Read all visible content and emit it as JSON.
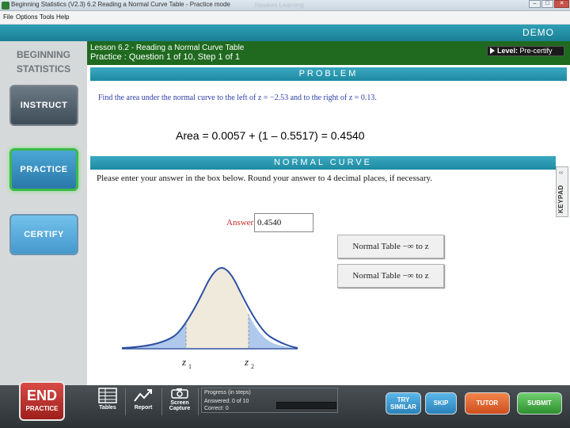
{
  "window": {
    "title": "Beginning Statistics (V2.3)   6.2 Reading a Normal Curve Table - Practice mode",
    "watermark": "Hawkes Learning",
    "minimize": "–",
    "maximize": "□",
    "close": "✕"
  },
  "menu": {
    "file": "File",
    "options": "Options",
    "tools": "Tools",
    "help": "Help"
  },
  "banner": {
    "demo": "DEMO"
  },
  "sidebar": {
    "brand_line1": "BEGINNING",
    "brand_line2": "STATISTICS",
    "instruct": "INSTRUCT",
    "practice": "PRACTICE",
    "certify": "CERTIFY"
  },
  "lesson": {
    "title": "Lesson 6.2 - Reading a Normal Curve Table",
    "step": "Practice : Question 1 of 10, Step 1 of 1",
    "level_key": "Level:",
    "level_value": "Pre-certify"
  },
  "problem": {
    "header": "PROBLEM",
    "text": "Find the area under the normal curve to the left of z = −2.53 and to the right of z = 0.13.",
    "result": "Area = 0.0057 + (1 – 0.5517) = 0.4540"
  },
  "curve_panel": {
    "header": "NORMAL CURVE",
    "instructions": "Please enter your answer in the box below.  Round your answer to 4 decimal places, if necessary.",
    "answer_label": "Answer:",
    "answer_value": "0.4540",
    "table_btn_1": "Normal Table  −∞  to  z",
    "table_btn_2": "Normal Table −∞ to z",
    "z1_label": "z",
    "z1_sub": "1",
    "z2_label": "z",
    "z2_sub": "2",
    "shading": {
      "left_tail": true,
      "right_tail": true,
      "middle_unshaded_tint": true
    }
  },
  "keypad": {
    "label": "KEYPAD",
    "chevron": "‹‹"
  },
  "toolbar": {
    "end": "END",
    "end_sub": "PRACTICE",
    "tables": "Tables",
    "report": "Report",
    "screen": "Screen",
    "capture": "Capture",
    "progress_title": "Progress (in steps)",
    "answered": "Answered:  0  of 10",
    "correct": "Correct:    0",
    "progress_fraction": 0.0,
    "try": "TRY",
    "similar": "SIMILAR",
    "skip": "SKIP",
    "tutor": "TUTOR",
    "submit": "SUBMIT"
  },
  "colors": {
    "header_green": "#1f6a1f",
    "panel_teal": "#1f8aa2",
    "curve_stroke": "#2b4fa0",
    "tail_fill": "#aec9ec",
    "middle_fill": "#efeadb"
  }
}
